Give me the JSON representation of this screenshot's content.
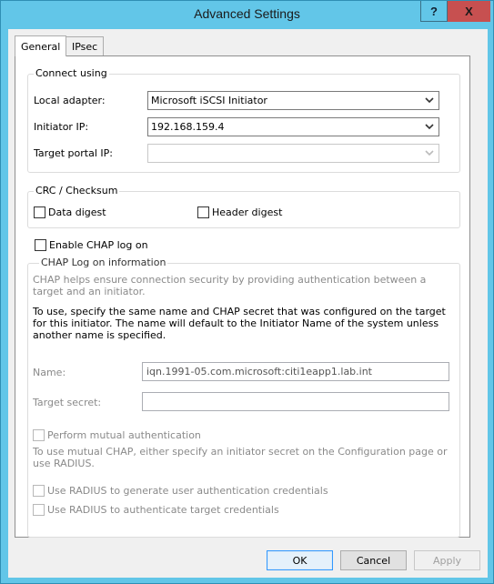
{
  "window": {
    "title": "Advanced Settings",
    "help_label": "?",
    "close_label": "X"
  },
  "tabs": [
    {
      "label": "General",
      "selected": true
    },
    {
      "label": "IPsec",
      "selected": false
    }
  ],
  "connect_using": {
    "title": "Connect using",
    "local_adapter": {
      "label": "Local adapter:",
      "value": "Microsoft iSCSI Initiator"
    },
    "initiator_ip": {
      "label": "Initiator IP:",
      "value": "192.168.159.4"
    },
    "target_portal_ip": {
      "label": "Target portal IP:",
      "value": ""
    }
  },
  "crc": {
    "title": "CRC / Checksum",
    "data_digest": {
      "label": "Data digest",
      "checked": false
    },
    "header_digest": {
      "label": "Header digest",
      "checked": false
    }
  },
  "enable_chap": {
    "label": "Enable CHAP log on",
    "checked": false
  },
  "chap_info": {
    "title": "CHAP Log on information",
    "description": "CHAP helps ensure connection security by providing authentication between a target and an initiator.",
    "instructions": "To use, specify the same name and CHAP secret that was configured on the target for this initiator.  The name will default to the Initiator Name of the system unless another name is specified.",
    "name": {
      "label": "Name:",
      "value": "iqn.1991-05.com.microsoft:citi1eapp1.lab.int"
    },
    "target_secret": {
      "label": "Target secret:",
      "value": ""
    },
    "mutual_auth": {
      "label": "Perform mutual authentication",
      "checked": false
    },
    "mutual_note": "To use mutual CHAP, either specify an initiator secret on the Configuration page or use RADIUS.",
    "radius_generate": {
      "label": "Use RADIUS to generate user authentication credentials",
      "checked": false
    },
    "radius_authenticate": {
      "label": "Use RADIUS to authenticate target credentials",
      "checked": false
    }
  },
  "buttons": {
    "ok": "OK",
    "cancel": "Cancel",
    "apply": "Apply"
  },
  "colors": {
    "title_bar": "#62c6e8",
    "close_button": "#c75050",
    "ok_border": "#3399ff"
  }
}
